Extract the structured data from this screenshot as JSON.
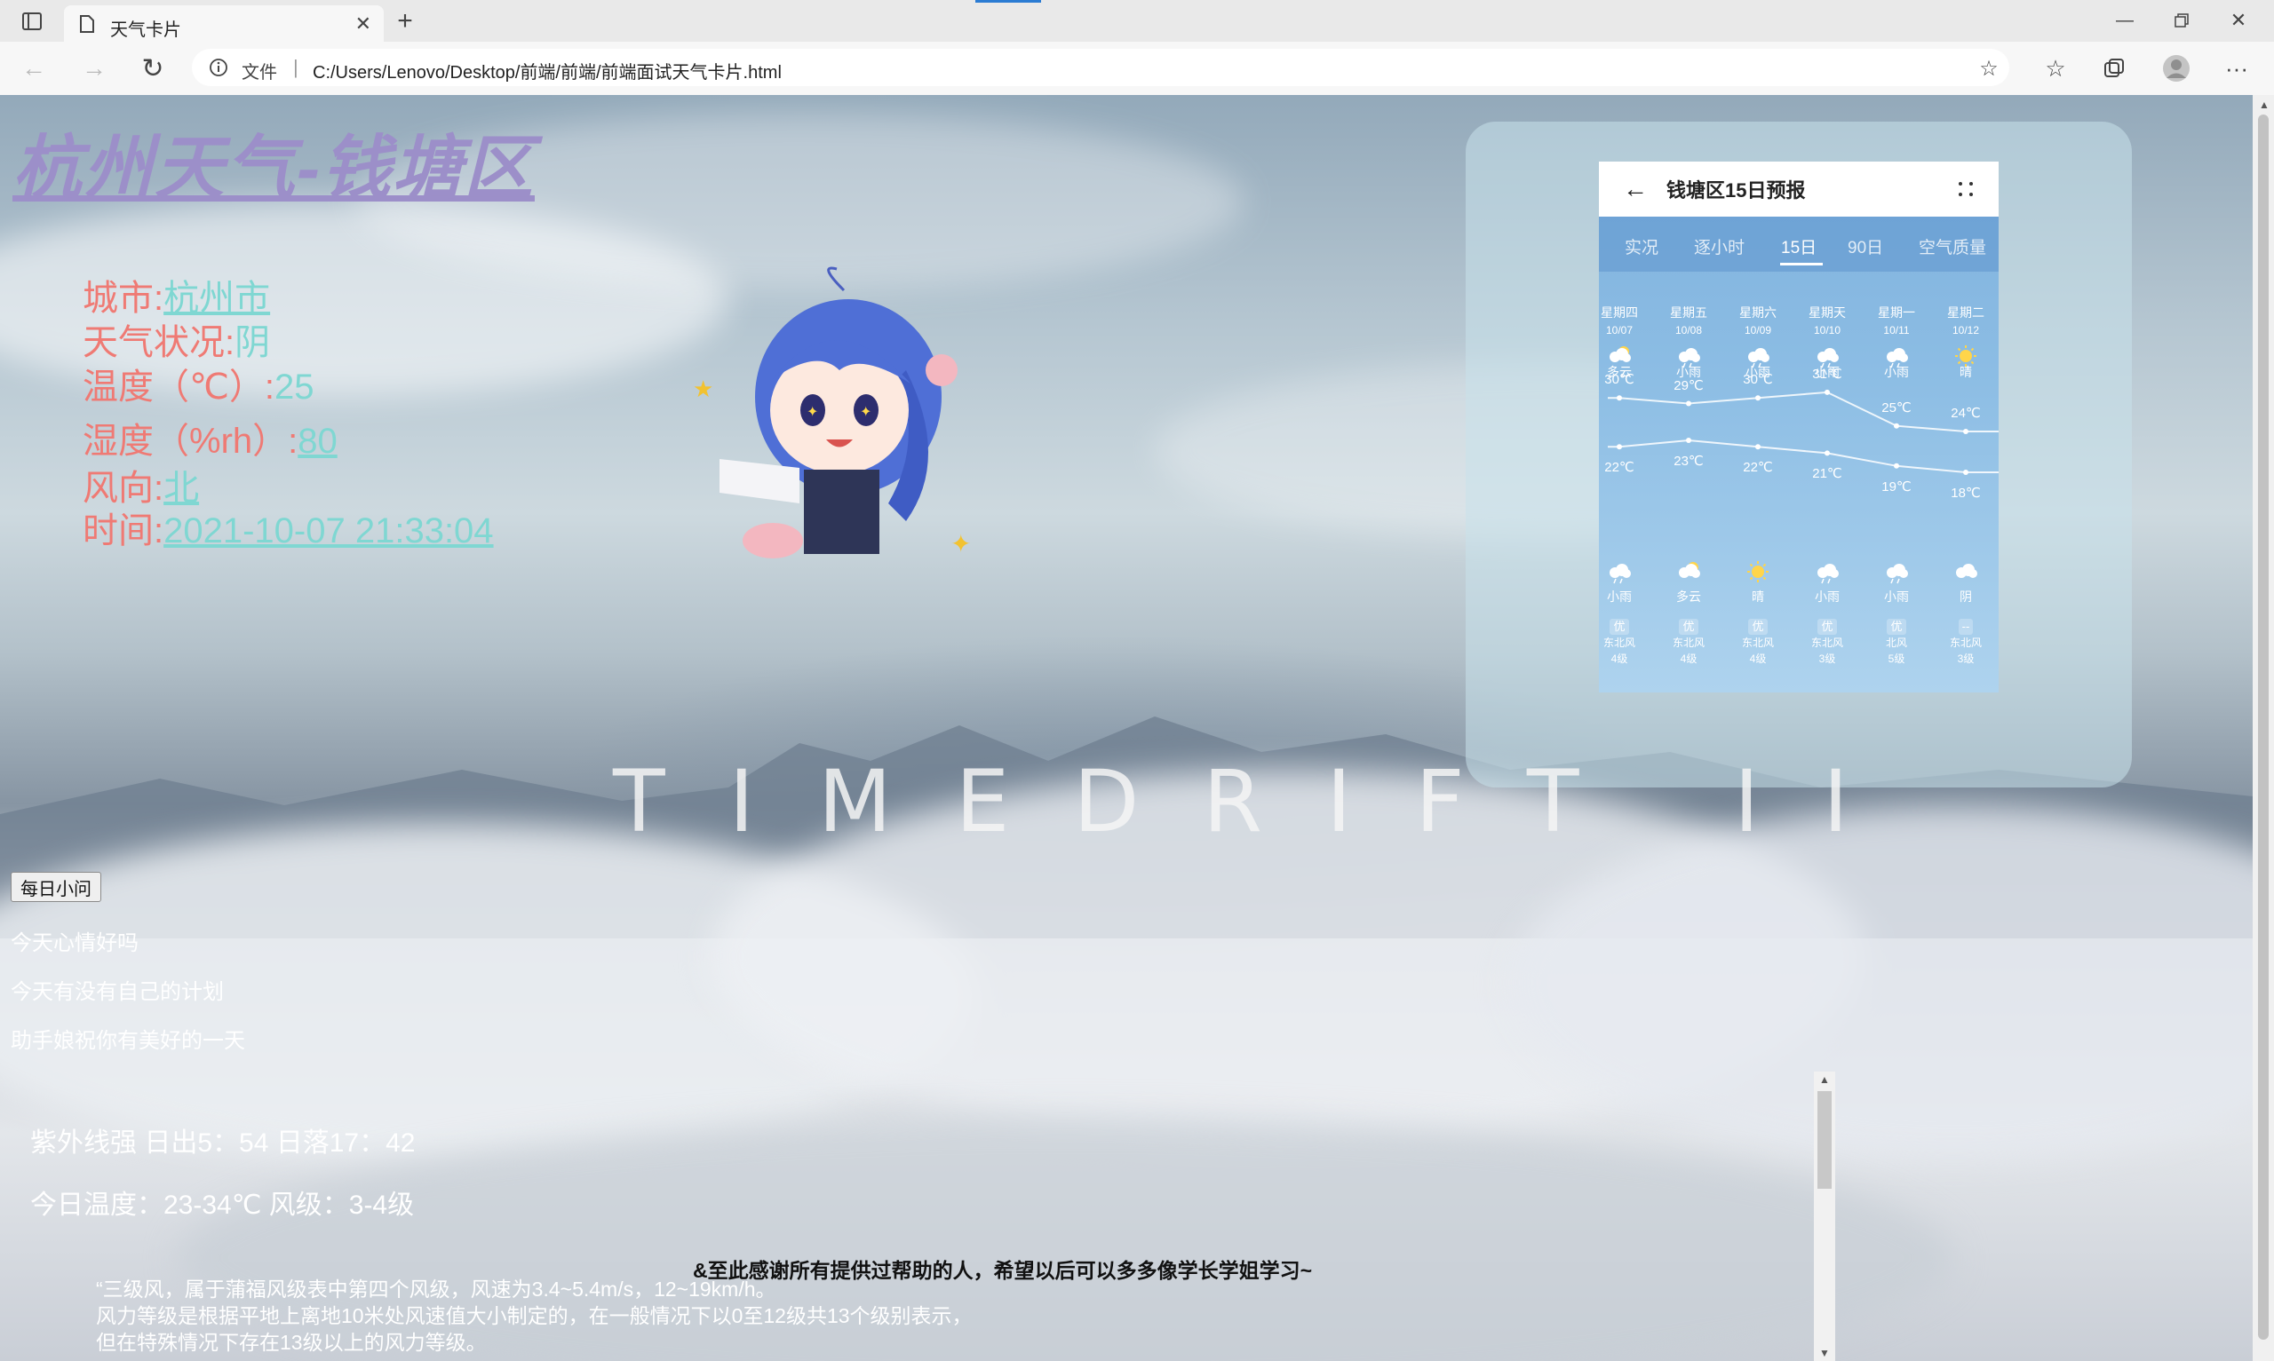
{
  "browser": {
    "tab_title": "天气卡片",
    "url_label": "文件",
    "url": "C:/Users/Lenovo/Desktop/前端/前端/前端面试天气卡片.html"
  },
  "page": {
    "title": "杭州天气-钱塘区",
    "info": {
      "city_label": "城市:",
      "city_value": "杭州市",
      "condition_label": "天气状况:",
      "condition_value": "阴",
      "temp_label": "温度（℃）:",
      "temp_value": "25",
      "humidity_label": "湿度（%rh）:",
      "humidity_value": "80",
      "wind_label": "风向:",
      "wind_value": "北",
      "time_label": "时间:",
      "time_value": "2021-10-07 21:33:04"
    },
    "watermark": "TIMEDRIFT II",
    "daily_button": "每日小问",
    "messages": [
      "今天心情好吗",
      "今天有没有自己的计划",
      "助手娘祝你有美好的一天"
    ],
    "uv_line": "紫外线强 日出5：54 日落17：42",
    "today_line": "今日温度：23-34℃ 风级：3-4级",
    "thanks": "&至此感谢所有提供过帮助的人，希望以后可以多多像学长学姐学习~",
    "wind_note_lines": [
      "“三级风，属于蒲福风级表中第四个风级，风速为3.4~5.4m/s，12~19km/h。",
      "风力等级是根据平地上离地10米处风速值大小制定的，在一般情况下以0至12级共13个级别表示，",
      "但在特殊情况下存在13级以上的风力等级。"
    ]
  },
  "forecast": {
    "title": "钱塘区15日预报",
    "tabs": [
      "实况",
      "逐小时",
      "15日",
      "90日",
      "空气质量"
    ],
    "selected_tab": "15日",
    "days": [
      {
        "weekday": "星期四",
        "date": "10/07",
        "day_cond": "多云",
        "high": "30℃",
        "low": "22℃",
        "night_cond": "小雨",
        "aqi": "优",
        "wind_dir": "东北风",
        "wind_level": "4级",
        "day_icon": "partly-cloudy-icon",
        "night_icon": "rain-cloud-icon"
      },
      {
        "weekday": "星期五",
        "date": "10/08",
        "day_cond": "小雨",
        "high": "29℃",
        "low": "23℃",
        "night_cond": "多云",
        "aqi": "优",
        "wind_dir": "东北风",
        "wind_level": "4级",
        "day_icon": "rain-cloud-icon",
        "night_icon": "partly-cloudy-icon"
      },
      {
        "weekday": "星期六",
        "date": "10/09",
        "day_cond": "小雨",
        "high": "30℃",
        "low": "22℃",
        "night_cond": "晴",
        "aqi": "优",
        "wind_dir": "东北风",
        "wind_level": "4级",
        "day_icon": "rain-cloud-icon",
        "night_icon": "sun-icon"
      },
      {
        "weekday": "星期天",
        "date": "10/10",
        "day_cond": "小雨",
        "high": "31℃",
        "low": "21℃",
        "night_cond": "小雨",
        "aqi": "优",
        "wind_dir": "东北风",
        "wind_level": "3级",
        "day_icon": "rain-cloud-icon",
        "night_icon": "rain-cloud-icon"
      },
      {
        "weekday": "星期一",
        "date": "10/11",
        "day_cond": "小雨",
        "high": "25℃",
        "low": "19℃",
        "night_cond": "小雨",
        "aqi": "优",
        "wind_dir": "北风",
        "wind_level": "5级",
        "day_icon": "rain-cloud-icon",
        "night_icon": "rain-cloud-icon"
      },
      {
        "weekday": "星期二",
        "date": "10/12",
        "day_cond": "晴",
        "high": "24℃",
        "low": "18℃",
        "night_cond": "阴",
        "aqi": "--",
        "wind_dir": "东北风",
        "wind_level": "3级",
        "day_icon": "sun-icon",
        "night_icon": "cloud-icon"
      }
    ]
  },
  "colors": {
    "title": "#9c8fc9",
    "info_label": "#ef7a74",
    "info_value": "#7fd7d2"
  }
}
